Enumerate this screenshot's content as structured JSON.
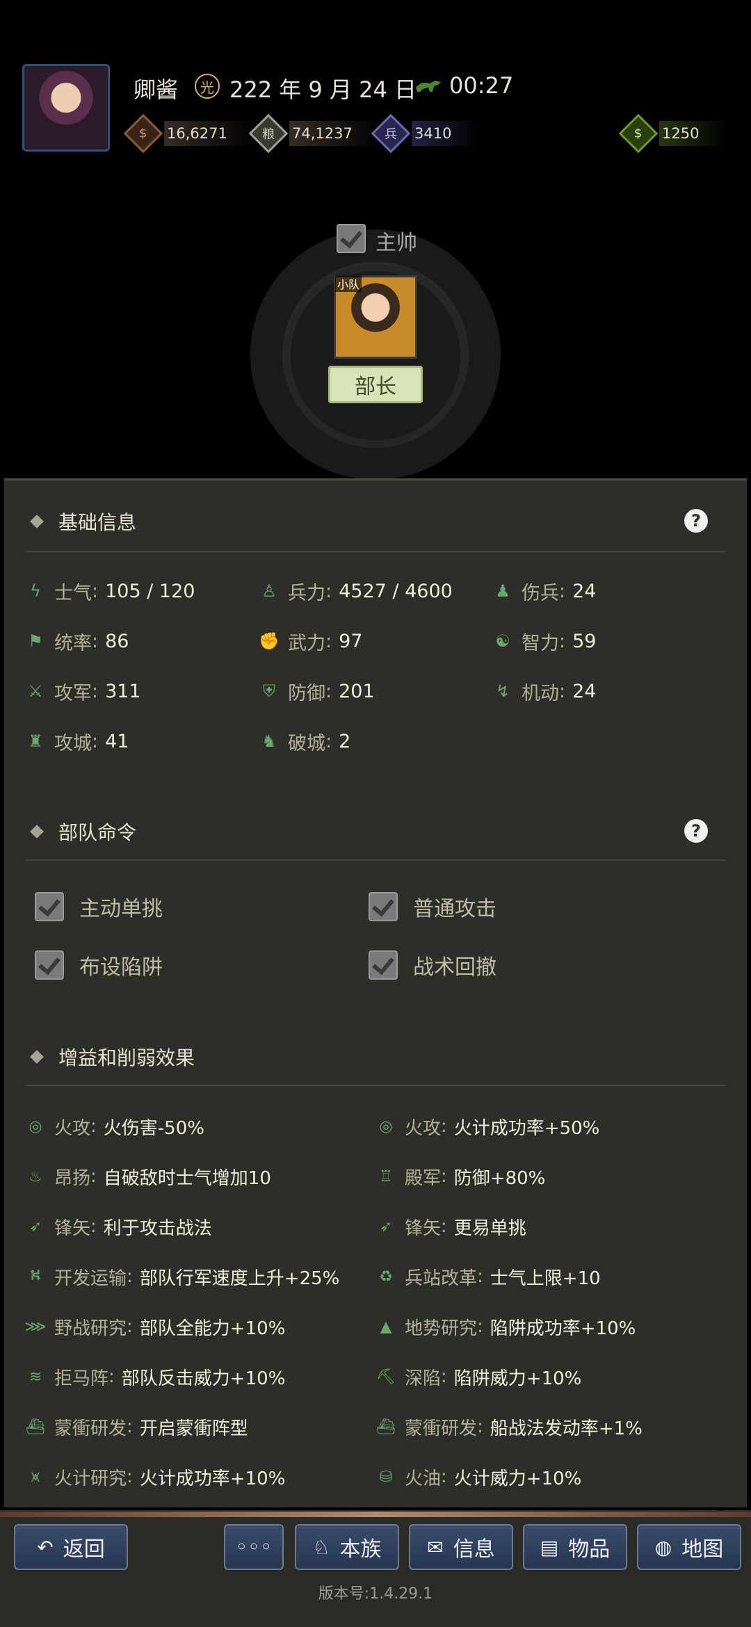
{
  "header": {
    "player_name": "卿酱",
    "date_icon_glyph": "光",
    "date": "222 年 9 月 24 日",
    "time": "00:27",
    "resources": [
      {
        "icon": "coin-bag-icon",
        "glyph": "$",
        "value": "16,6271",
        "color": "#8a5a3a"
      },
      {
        "icon": "grain-icon",
        "glyph": "粮",
        "value": "74,1237",
        "color": "#a0a090"
      },
      {
        "icon": "soldier-icon",
        "glyph": "兵",
        "value": "3410",
        "color": "#6a6ab0"
      },
      {
        "icon": "money-pouch-icon",
        "glyph": "$",
        "value": "1250",
        "color": "#6a9a30"
      }
    ]
  },
  "commander": {
    "checkbox_label": "主帅",
    "unit_tag": "小队",
    "role_button": "部长"
  },
  "basic_info": {
    "title": "基础信息",
    "stats": [
      {
        "icon": "morale-icon",
        "glyph": "ϟ",
        "label": "士气",
        "value": "105 / 120"
      },
      {
        "icon": "troops-icon",
        "glyph": "♙",
        "label": "兵力",
        "value": "4527 / 4600"
      },
      {
        "icon": "wounded-icon",
        "glyph": "♟",
        "label": "伤兵",
        "value": "24"
      },
      {
        "icon": "command-flag-icon",
        "glyph": "⚑",
        "label": "统率",
        "value": "86"
      },
      {
        "icon": "strength-arm-icon",
        "glyph": "✊",
        "label": "武力",
        "value": "97"
      },
      {
        "icon": "intelligence-head-icon",
        "glyph": "☯",
        "label": "智力",
        "value": "59"
      },
      {
        "icon": "crossed-swords-icon",
        "glyph": "⚔",
        "label": "攻军",
        "value": "311"
      },
      {
        "icon": "shield-soldier-icon",
        "glyph": "⛨",
        "label": "防御",
        "value": "201"
      },
      {
        "icon": "mobility-icon",
        "glyph": "↯",
        "label": "机动",
        "value": "24"
      },
      {
        "icon": "siege-tower-icon",
        "glyph": "♜",
        "label": "攻城",
        "value": "41"
      },
      {
        "icon": "horse-icon",
        "glyph": "♞",
        "label": "破城",
        "value": "2"
      }
    ]
  },
  "unit_orders": {
    "title": "部队命令",
    "items": [
      {
        "label": "主动单挑",
        "checked": true
      },
      {
        "label": "普通攻击",
        "checked": true
      },
      {
        "label": "布设陷阱",
        "checked": true
      },
      {
        "label": "战术回撤",
        "checked": true
      }
    ]
  },
  "effects": {
    "title": "增益和削弱效果",
    "items": [
      {
        "icon": "fire-ring-icon",
        "glyph": "◎",
        "label": "火攻",
        "value": "火伤害-50%"
      },
      {
        "icon": "fire-ring-icon",
        "glyph": "◎",
        "label": "火攻",
        "value": "火计成功率+50%"
      },
      {
        "icon": "drum-icon",
        "glyph": "♨",
        "label": "昂扬",
        "value": "自破敌时士气增加10"
      },
      {
        "icon": "rearguard-icon",
        "glyph": "♖",
        "label": "殿军",
        "value": "防御+80%"
      },
      {
        "icon": "arrow-volley-icon",
        "glyph": "➶",
        "label": "锋矢",
        "value": "利于攻击战法"
      },
      {
        "icon": "arrow-volley-icon",
        "glyph": "➶",
        "label": "锋矢",
        "value": "更易单挑"
      },
      {
        "icon": "transport-icon",
        "glyph": "⛕",
        "label": "开发运输",
        "value": "部队行军速度上升+25%"
      },
      {
        "icon": "supply-station-icon",
        "glyph": "♻",
        "label": "兵站改革",
        "value": "士气上限+10"
      },
      {
        "icon": "field-battle-icon",
        "glyph": "⋙",
        "label": "野战研究",
        "value": "部队全能力+10%"
      },
      {
        "icon": "terrain-icon",
        "glyph": "▲",
        "label": "地势研究",
        "value": "陷阱成功率+10%"
      },
      {
        "icon": "spike-barrier-icon",
        "glyph": "≋",
        "label": "拒马阵",
        "value": "部队反击威力+10%"
      },
      {
        "icon": "pit-trap-icon",
        "glyph": "⛏",
        "label": "深陷",
        "value": "陷阱威力+10%"
      },
      {
        "icon": "warship-icon",
        "glyph": "⛴",
        "label": "蒙衝研发",
        "value": "开启蒙衝阵型"
      },
      {
        "icon": "warship-icon",
        "glyph": "⛴",
        "label": "蒙衝研发",
        "value": "船战法发动率+1%"
      },
      {
        "icon": "fire-research-icon",
        "glyph": "⩙",
        "label": "火计研究",
        "value": "火计成功率+10%"
      },
      {
        "icon": "oil-barrel-icon",
        "glyph": "⛁",
        "label": "火油",
        "value": "火计威力+10%"
      }
    ]
  },
  "nav": {
    "back": "返回",
    "more": "◦◦◦",
    "clan": "本族",
    "info": "信息",
    "items": "物品",
    "map": "地图"
  },
  "version": "版本号:1.4.29.1"
}
